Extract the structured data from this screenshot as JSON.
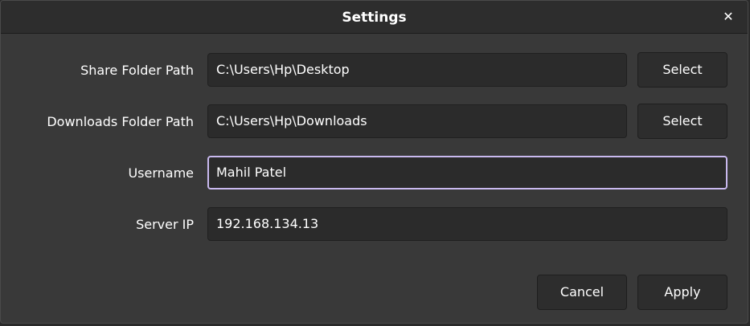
{
  "dialog": {
    "title": "Settings",
    "close_glyph": "✕"
  },
  "fields": {
    "share_folder": {
      "label": "Share Folder Path",
      "value": "C:\\Users\\Hp\\Desktop",
      "button_label": "Select"
    },
    "downloads_folder": {
      "label": "Downloads Folder Path",
      "value": "C:\\Users\\Hp\\Downloads",
      "button_label": "Select"
    },
    "username": {
      "label": "Username",
      "value": "Mahil Patel"
    },
    "server_ip": {
      "label": "Server IP",
      "value": "192.168.134.13"
    }
  },
  "footer": {
    "cancel_label": "Cancel",
    "apply_label": "Apply"
  },
  "colors": {
    "background": "#393939",
    "titlebar": "#2d2d2d",
    "field_background": "#2b2b2b",
    "focus_border": "#c9b9ef",
    "text": "#ffffff"
  }
}
